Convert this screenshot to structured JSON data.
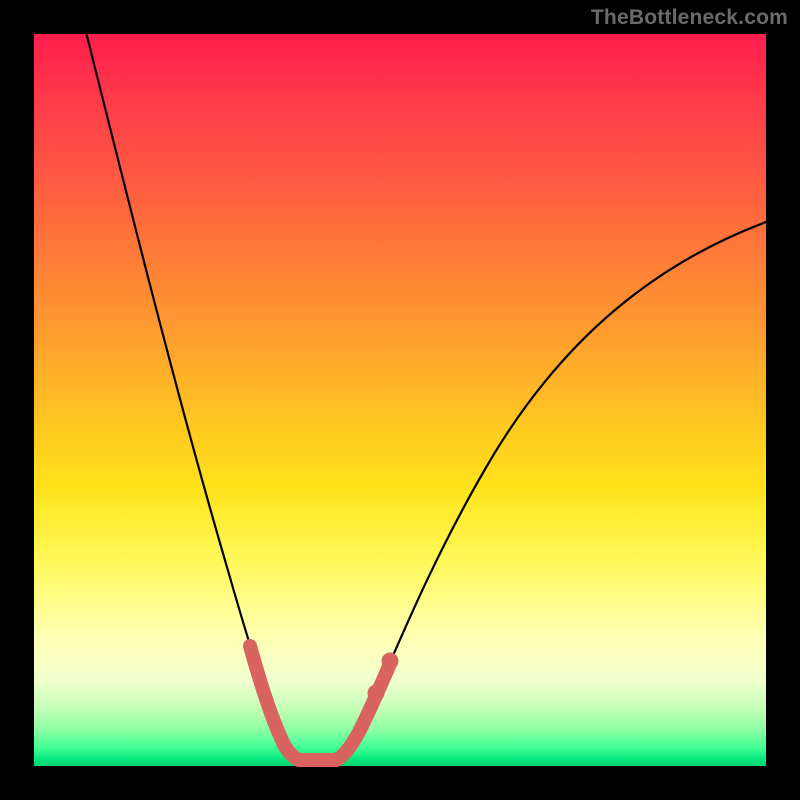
{
  "watermark": "TheBottleneck.com",
  "chart_data": {
    "type": "line",
    "title": "",
    "xlabel": "",
    "ylabel": "",
    "series": [
      {
        "name": "curve",
        "x": [
          0.0,
          0.03,
          0.06,
          0.09,
          0.12,
          0.15,
          0.18,
          0.21,
          0.24,
          0.27,
          0.3,
          0.33,
          0.36,
          0.39,
          0.42,
          0.45,
          0.48,
          0.51,
          0.55,
          0.6,
          0.66,
          0.73,
          0.8,
          0.88,
          1.0
        ],
        "y": [
          1.0,
          0.85,
          0.71,
          0.58,
          0.46,
          0.36,
          0.27,
          0.2,
          0.14,
          0.09,
          0.05,
          0.02,
          0.01,
          0.01,
          0.02,
          0.04,
          0.08,
          0.13,
          0.19,
          0.26,
          0.34,
          0.43,
          0.52,
          0.61,
          0.72
        ]
      }
    ],
    "highlight_segments": [
      {
        "side": "left",
        "x_range": [
          0.27,
          0.33
        ],
        "note": "pink thick stroke on left wall of valley"
      },
      {
        "side": "floor",
        "x_range": [
          0.33,
          0.42
        ],
        "note": "flat bottom"
      },
      {
        "side": "right",
        "x_range": [
          0.42,
          0.49
        ],
        "note": "pink thick stroke on right wall"
      }
    ],
    "xlim": [
      0,
      1
    ],
    "ylim": [
      0,
      1
    ],
    "colors": {
      "curve": "#000000",
      "highlight": "#d9635f",
      "highlight_dot": "#d9635f"
    }
  }
}
